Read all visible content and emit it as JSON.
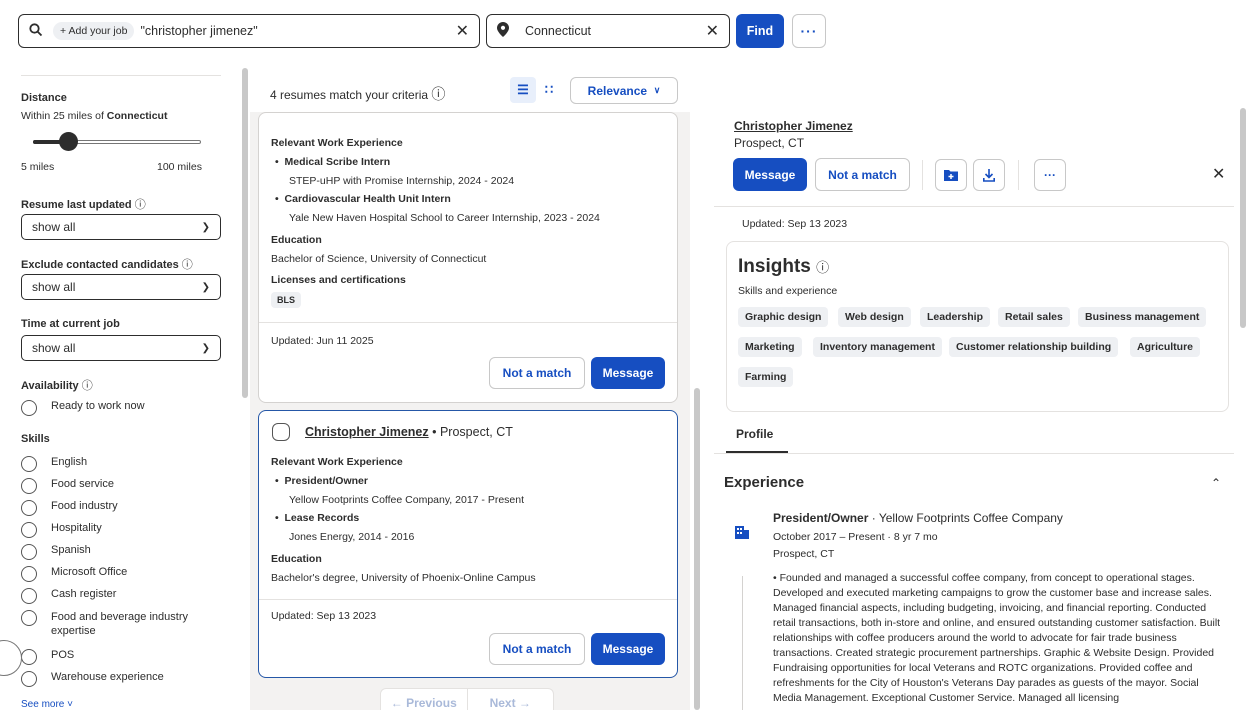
{
  "search": {
    "add_job_label": "+ Add your job",
    "query": "\"christopher jimenez\"",
    "location": "Connecticut",
    "find_label": "Find",
    "more_label": "···"
  },
  "filters": {
    "distance_title": "Distance",
    "distance_prefix": "Within 25 miles of ",
    "distance_place": "Connecticut",
    "distance_value_miles": 5,
    "slider_min": "5 miles",
    "slider_max": "100 miles",
    "resume_updated_title": "Resume last updated",
    "resume_updated_value": "show all",
    "exclude_title": "Exclude contacted candidates",
    "exclude_value": "show all",
    "time_title": "Time at current job",
    "time_value": "show all",
    "availability_title": "Availability",
    "availability_option": "Ready to work now",
    "skills_title": "Skills",
    "skills": [
      "English",
      "Food service",
      "Food industry",
      "Hospitality",
      "Spanish",
      "Microsoft Office",
      "Cash register",
      "Food and beverage industry expertise",
      "POS",
      "Warehouse experience"
    ],
    "see_more": "See more"
  },
  "list": {
    "count": "4 resumes match your criteria",
    "sort_label": "Relevance",
    "card1": {
      "rwe_title": "Relevant Work Experience",
      "job1_title": "Medical Scribe Intern",
      "job1_org": "STEP-uHP with Promise Internship, 2024 - 2024",
      "job2_title": "Cardiovascular Health Unit Intern",
      "job2_org": "Yale New Haven Hospital School to Career Internship, 2023 - 2024",
      "edu_title": "Education",
      "edu": "Bachelor of Science, University of Connecticut",
      "lic_title": "Licenses and certifications",
      "lic": "BLS",
      "updated": "Updated: Jun 11 2025",
      "not_match": "Not a match",
      "message": "Message"
    },
    "card2": {
      "name": "Christopher Jimenez",
      "location": " • Prospect, CT",
      "rwe_title": "Relevant Work Experience",
      "job1_title": "President/Owner",
      "job1_org": "Yellow Footprints Coffee Company, 2017 - Present",
      "job2_title": "Lease Records",
      "job2_org": "Jones Energy, 2014 - 2016",
      "edu_title": "Education",
      "edu": "Bachelor's degree, University of Phoenix-Online Campus",
      "updated": "Updated: Sep 13 2023",
      "not_match": "Not a match",
      "message": "Message"
    },
    "pager_prev": "← Previous",
    "pager_next": "Next →"
  },
  "detail": {
    "name": "Christopher Jimenez",
    "location": "Prospect, CT",
    "message": "Message",
    "not_match": "Not a match",
    "updated": "Updated: Sep 13 2023",
    "insights_title": "Insights",
    "insights_sub": "Skills and experience",
    "tags": [
      "Graphic design",
      "Web design",
      "Leadership",
      "Retail sales",
      "Business management",
      "Marketing",
      "Inventory management",
      "Customer relationship building",
      "Agriculture",
      "Farming"
    ],
    "profile_tab": "Profile",
    "experience_title": "Experience",
    "exp_role": "President/Owner",
    "exp_company": " · Yellow Footprints Coffee Company",
    "exp_dates": "October 2017 – Present · 8 yr 7 mo",
    "exp_location": "Prospect, CT",
    "exp_desc": "• Founded and managed a successful coffee company, from concept to operational stages. Developed and executed marketing campaigns to grow the customer base and increase sales. Managed financial aspects, including budgeting, invoicing, and financial reporting. Conducted retail transactions, both in-store and online, and ensured outstanding customer satisfaction. Built relationships with coffee producers around the world to advocate for fair trade business transactions. Created strategic procurement partnerships. Graphic & Website Design. Provided Fundraising opportunities for local Veterans and ROTC organizations. Provided coffee and refreshments for the City of Houston's Veterans Day parades as guests of the mayor. Social Media Management. Exceptional Customer Service. Managed all licensing"
  },
  "colors": {
    "accent": "#164ec1",
    "chip_bg": "#eef0f3",
    "panel_bg": "#f3f2f1"
  }
}
